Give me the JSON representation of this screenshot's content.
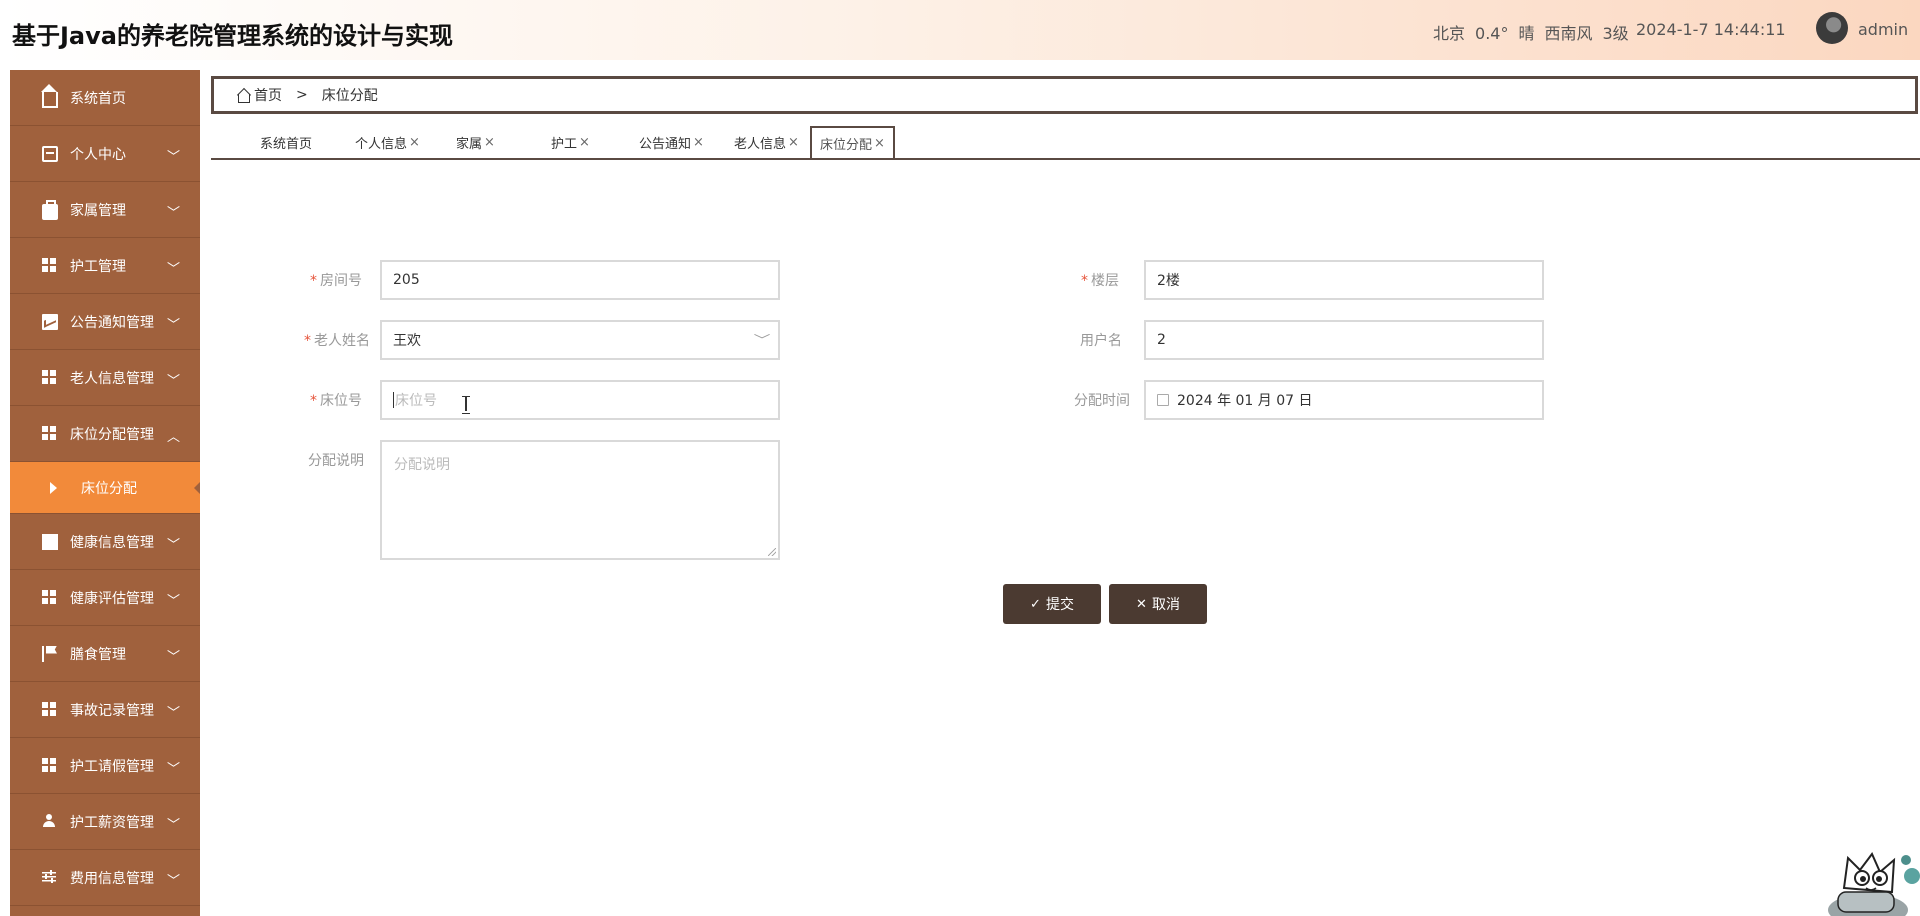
{
  "header": {
    "title": "基于Java的养老院管理系统的设计与实现",
    "weather": {
      "city": "北京",
      "temp": "0.4°",
      "condition": "晴",
      "wind": "西南风",
      "level": "3级"
    },
    "datetime": "2024-1-7 14:44:11",
    "user": "admin"
  },
  "sidebar": {
    "items": [
      {
        "label": "系统首页",
        "icon": "home-icon"
      },
      {
        "label": "个人中心",
        "icon": "card-icon"
      },
      {
        "label": "家属管理",
        "icon": "briefcase-icon"
      },
      {
        "label": "护工管理",
        "icon": "grid-icon"
      },
      {
        "label": "公告通知管理",
        "icon": "chart-icon"
      },
      {
        "label": "老人信息管理",
        "icon": "grid-icon"
      },
      {
        "label": "床位分配管理",
        "icon": "grid-icon"
      },
      {
        "label": "床位分配",
        "icon": "triangle-right-icon"
      },
      {
        "label": "健康信息管理",
        "icon": "table-icon"
      },
      {
        "label": "健康评估管理",
        "icon": "grid-icon"
      },
      {
        "label": "膳食管理",
        "icon": "flag-icon"
      },
      {
        "label": "事故记录管理",
        "icon": "grid-icon"
      },
      {
        "label": "护工请假管理",
        "icon": "grid-icon"
      },
      {
        "label": "护工薪资管理",
        "icon": "user-icon"
      },
      {
        "label": "费用信息管理",
        "icon": "sliders-icon"
      }
    ]
  },
  "breadcrumb": {
    "home": "首页",
    "separator": ">",
    "current": "床位分配"
  },
  "tabs": [
    {
      "label": "系统首页"
    },
    {
      "label": "个人信息"
    },
    {
      "label": "家属"
    },
    {
      "label": "护工"
    },
    {
      "label": "公告通知"
    },
    {
      "label": "老人信息"
    },
    {
      "label": "床位分配"
    }
  ],
  "form": {
    "room_label": "房间号",
    "room_value": "205",
    "floor_label": "楼层",
    "floor_value": "2楼",
    "elder_label": "老人姓名",
    "elder_value": "王欢",
    "username_label": "用户名",
    "username_value": "2",
    "bed_label": "床位号",
    "bed_placeholder": "床位号",
    "time_label": "分配时间",
    "time_value": "2024 年 01 月 07 日",
    "note_label": "分配说明",
    "note_placeholder": "分配说明",
    "submit": "提交",
    "cancel": "取消"
  },
  "colors": {
    "sidebar": "#a0613d",
    "sidebar_active": "#f28a3a",
    "button": "#4b3a31",
    "required": "#e6533a"
  }
}
